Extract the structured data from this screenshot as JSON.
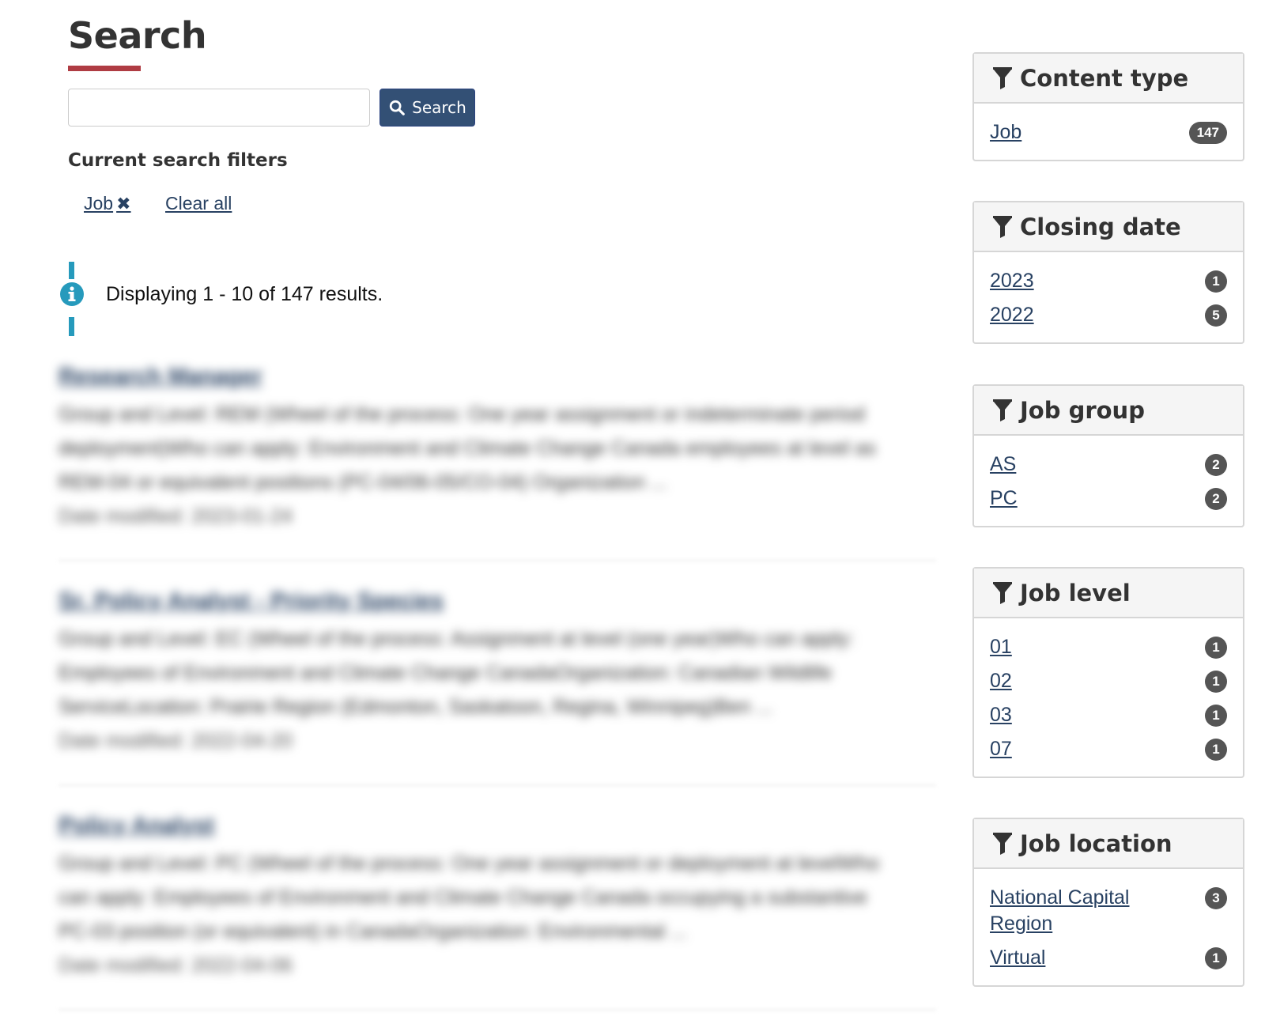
{
  "page": {
    "title": "Search"
  },
  "search": {
    "query": "",
    "placeholder": "",
    "button_label": "Search"
  },
  "current_filters": {
    "heading": "Current search filters",
    "active": [
      {
        "label": "Job",
        "remove_icon": "x-icon"
      }
    ],
    "clear_all_label": "Clear all"
  },
  "results_info": {
    "text": "Displaying 1 - 10 of 147 results."
  },
  "results": [
    {
      "title": "Research Manager",
      "lines": [
        "Group and Level: REM (Wheel of the process: One year assignment or indeterminate period",
        "deployment)Who can apply: Environment and Climate Change Canada employees at level as",
        "REM-04 or equivalent positions (PC-04/06-05/CO-04) Organization ..."
      ],
      "date": "Date modified: 2023-01-24"
    },
    {
      "title": "Sr. Policy Analyst - Priority Species",
      "lines": [
        "Group and Level: EC (Wheel of the process: Assignment at level (one year)Who can apply:",
        "Employees of Environment and Climate Change CanadaOrganization: Canadian Wildlife",
        "ServiceLocation: Prairie Region (Edmonton, Saskatoon, Regina, Winnipeg)Ben ..."
      ],
      "date": "Date modified: 2022-04-20"
    },
    {
      "title": "Policy Analyst",
      "lines": [
        "Group and Level: PC (Wheel of the process: One year assignment or deployment at levelWho",
        "can apply: Employees of Environment and Climate Change Canada occupying a substantive",
        "PC-03 position (or equivalent) in CanadaOrganization: Environmental ..."
      ],
      "date": "Date modified: 2022-04-06"
    }
  ],
  "facets": [
    {
      "title": "Content type",
      "icon": "filter-icon",
      "items": [
        {
          "label": "Job",
          "count": "147"
        }
      ]
    },
    {
      "title": "Closing date",
      "icon": "filter-icon",
      "items": [
        {
          "label": "2023",
          "count": "1"
        },
        {
          "label": "2022",
          "count": "5"
        }
      ]
    },
    {
      "title": "Job group",
      "icon": "filter-icon",
      "items": [
        {
          "label": "AS",
          "count": "2"
        },
        {
          "label": "PC",
          "count": "2"
        }
      ]
    },
    {
      "title": "Job level",
      "icon": "filter-icon",
      "items": [
        {
          "label": "01",
          "count": "1"
        },
        {
          "label": "02",
          "count": "1"
        },
        {
          "label": "03",
          "count": "1"
        },
        {
          "label": "07",
          "count": "1"
        }
      ]
    },
    {
      "title": "Job location",
      "icon": "filter-icon",
      "items": [
        {
          "label": "National Capital Region",
          "count": "3"
        },
        {
          "label": "Virtual",
          "count": "1"
        }
      ]
    }
  ],
  "colors": {
    "accent_red": "#af3c43",
    "button_blue": "#335075",
    "link_blue": "#284162",
    "info_blue": "#269abc",
    "badge_gray": "#555555"
  }
}
